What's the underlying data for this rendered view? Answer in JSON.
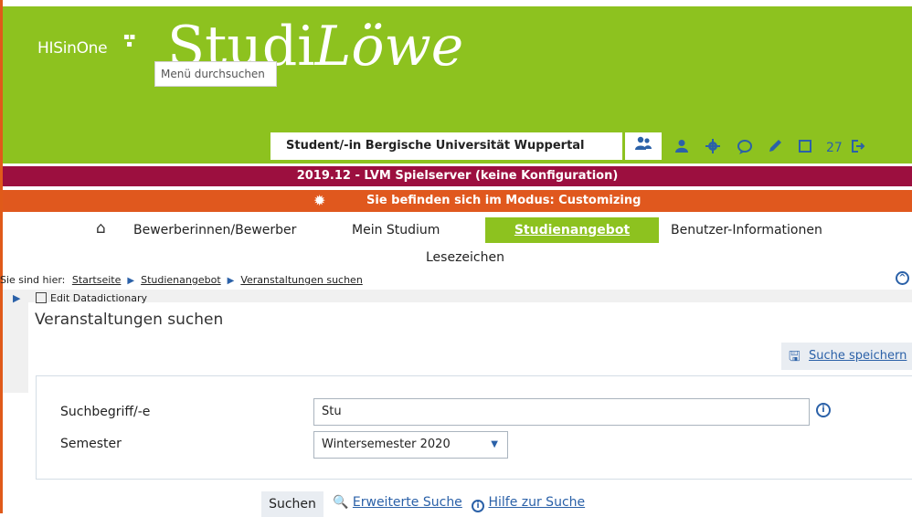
{
  "brand": {
    "hisinone": "HISinOne",
    "logo_prefix": "Studi",
    "logo_suffix": "Löwe",
    "menu_search_placeholder": "Menü durchsuchen"
  },
  "header": {
    "role": "Student/-in Bergische Universität Wuppertal",
    "count": "27"
  },
  "server_bar": "2019.12 - LVM Spielserver (keine Konfiguration)",
  "mode_bar": "Sie befinden sich im Modus: Customizing",
  "nav": {
    "applicants": "Bewerberinnen/Bewerber",
    "my_studies": "Mein Studium",
    "course_offer": "Studienangebot",
    "user_info": "Benutzer-Informationen",
    "bookmarks": "Lesezeichen"
  },
  "breadcrumb": {
    "prefix": "Sie sind hier:",
    "items": [
      "Startseite",
      "Studienangebot",
      "Veranstaltungen suchen"
    ]
  },
  "edit_datadictionary": "Edit Datadictionary",
  "page_title": "Veranstaltungen suchen",
  "save_search": "Suche speichern",
  "form": {
    "search_label": "Suchbegriff/-e",
    "search_value": "Stu",
    "semester_label": "Semester",
    "semester_value": "Wintersemester 2020"
  },
  "actions": {
    "search": "Suchen",
    "advanced": "Erweiterte Suche",
    "help": "Hilfe zur Suche"
  },
  "colors": {
    "green": "#8dc21f",
    "red": "#9c0f3f",
    "orange": "#e0581e",
    "blue": "#2b61a8"
  }
}
